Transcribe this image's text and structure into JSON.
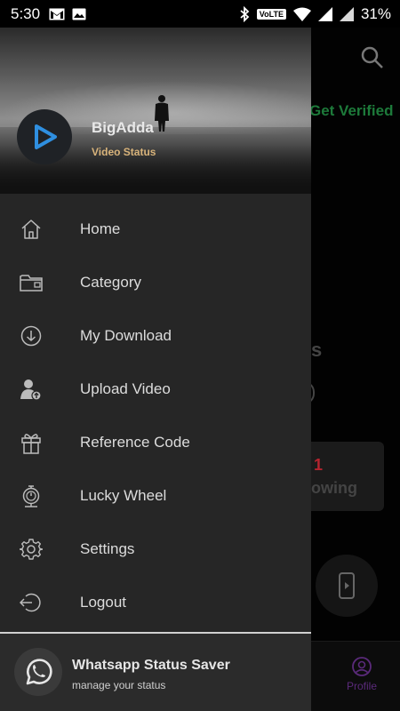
{
  "status_bar": {
    "time": "5:30",
    "network_label": "VoLTE",
    "battery": "31%"
  },
  "background_app": {
    "get_verified": "Get Verified",
    "partial_heading": "s",
    "stat_count": "1",
    "stat_label": "owing",
    "nav_profile": "Profile"
  },
  "drawer": {
    "header": {
      "app_name": "BigAdda",
      "app_subtitle": "Video Status"
    },
    "items": [
      {
        "label": "Home",
        "icon": "home-icon"
      },
      {
        "label": "Category",
        "icon": "folder-icon"
      },
      {
        "label": "My Download",
        "icon": "download-icon"
      },
      {
        "label": "Upload Video",
        "icon": "user-upload-icon"
      },
      {
        "label": "Reference Code",
        "icon": "gift-icon"
      },
      {
        "label": "Lucky Wheel",
        "icon": "stopwatch-icon"
      },
      {
        "label": "Settings",
        "icon": "gear-icon"
      },
      {
        "label": "Logout",
        "icon": "logout-icon"
      }
    ],
    "footer": {
      "title": "Whatsapp Status Saver",
      "subtitle": "manage your status"
    }
  },
  "colors": {
    "drawer_bg": "#262626",
    "verified_green": "#1d7a3a",
    "subtitle_gold": "#d8b37a",
    "logo_blue": "#2f8fe0",
    "count_red": "#b5242f"
  }
}
